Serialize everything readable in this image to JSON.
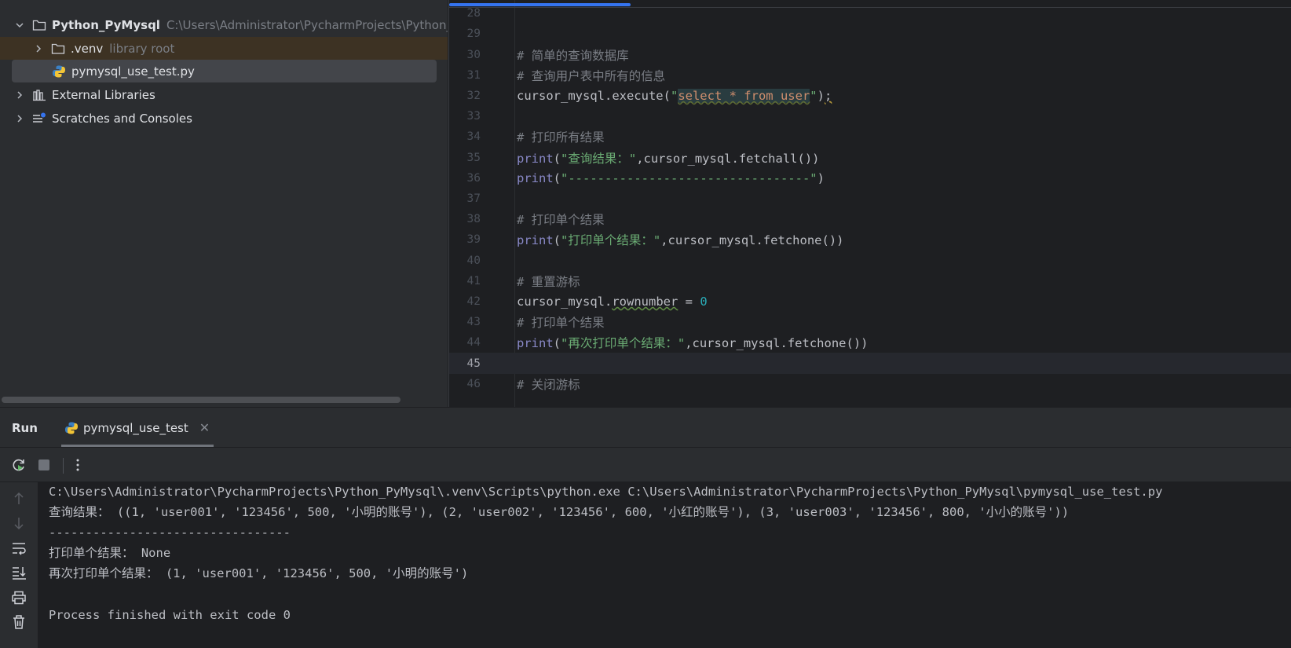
{
  "project_tree": {
    "project": {
      "name": "Python_PyMysql",
      "path": "C:\\Users\\Administrator\\PycharmProjects\\Python_Py"
    },
    "venv": {
      "name": ".venv",
      "hint": "library root"
    },
    "file": {
      "name": "pymysql_use_test.py"
    },
    "external_libraries": "External Libraries",
    "scratches": "Scratches and Consoles"
  },
  "editor": {
    "lines": [
      {
        "num": "28",
        "tokens": []
      },
      {
        "num": "29",
        "tokens": []
      },
      {
        "num": "30",
        "tokens": [
          {
            "t": "# 简单的查询数据库",
            "c": "com"
          }
        ]
      },
      {
        "num": "31",
        "tokens": [
          {
            "t": "# 查询用户表中所有的信息",
            "c": "com"
          }
        ]
      },
      {
        "num": "32",
        "tokens": [
          {
            "t": "cursor_mysql.execute(",
            "c": ""
          },
          {
            "t": "\"",
            "c": "str"
          },
          {
            "t": "select * from user",
            "c": "sql"
          },
          {
            "t": "\"",
            "c": "str"
          },
          {
            "t": ")",
            "c": ""
          },
          {
            "t": ";",
            "c": "semi"
          }
        ]
      },
      {
        "num": "33",
        "tokens": []
      },
      {
        "num": "34",
        "tokens": [
          {
            "t": "# 打印所有结果",
            "c": "com"
          }
        ]
      },
      {
        "num": "35",
        "tokens": [
          {
            "t": "print",
            "c": "kw"
          },
          {
            "t": "(",
            "c": ""
          },
          {
            "t": "\"查询结果：\"",
            "c": "str"
          },
          {
            "t": ",cursor_mysql.fetchall())",
            "c": ""
          }
        ]
      },
      {
        "num": "36",
        "tokens": [
          {
            "t": "print",
            "c": "kw"
          },
          {
            "t": "(",
            "c": ""
          },
          {
            "t": "\"---------------------------------\"",
            "c": "str"
          },
          {
            "t": ")",
            "c": ""
          }
        ]
      },
      {
        "num": "37",
        "tokens": []
      },
      {
        "num": "38",
        "tokens": [
          {
            "t": "# 打印单个结果",
            "c": "com"
          }
        ]
      },
      {
        "num": "39",
        "tokens": [
          {
            "t": "print",
            "c": "kw"
          },
          {
            "t": "(",
            "c": ""
          },
          {
            "t": "\"打印单个结果：\"",
            "c": "str"
          },
          {
            "t": ",cursor_mysql.fetchone())",
            "c": ""
          }
        ]
      },
      {
        "num": "40",
        "tokens": []
      },
      {
        "num": "41",
        "tokens": [
          {
            "t": "# 重置游标",
            "c": "com"
          }
        ]
      },
      {
        "num": "42",
        "tokens": [
          {
            "t": "cursor_mysql.",
            "c": ""
          },
          {
            "t": "rownumber",
            "c": "attr"
          },
          {
            "t": " = ",
            "c": ""
          },
          {
            "t": "0",
            "c": "num"
          }
        ]
      },
      {
        "num": "43",
        "tokens": [
          {
            "t": "# 打印单个结果",
            "c": "com"
          }
        ]
      },
      {
        "num": "44",
        "tokens": [
          {
            "t": "print",
            "c": "kw"
          },
          {
            "t": "(",
            "c": ""
          },
          {
            "t": "\"再次打印单个结果：\"",
            "c": "str"
          },
          {
            "t": ",cursor_mysql.fetchone())",
            "c": ""
          }
        ]
      },
      {
        "num": "45",
        "tokens": [],
        "current": true
      },
      {
        "num": "46",
        "tokens": [
          {
            "t": "# 关闭游标",
            "c": "com"
          }
        ]
      }
    ]
  },
  "run_panel": {
    "title": "Run",
    "tab_label": "pymysql_use_test",
    "console_lines": [
      "C:\\Users\\Administrator\\PycharmProjects\\Python_PyMysql\\.venv\\Scripts\\python.exe C:\\Users\\Administrator\\PycharmProjects\\Python_PyMysql\\pymysql_use_test.py",
      "查询结果： ((1, 'user001', '123456', 500, '小明的账号'), (2, 'user002', '123456', 600, '小红的账号'), (3, 'user003', '123456', 800, '小小的账号'))",
      "---------------------------------",
      "打印单个结果： None",
      "再次打印单个结果： (1, 'user001', '123456', 500, '小明的账号')",
      "",
      "Process finished with exit code 0"
    ]
  }
}
